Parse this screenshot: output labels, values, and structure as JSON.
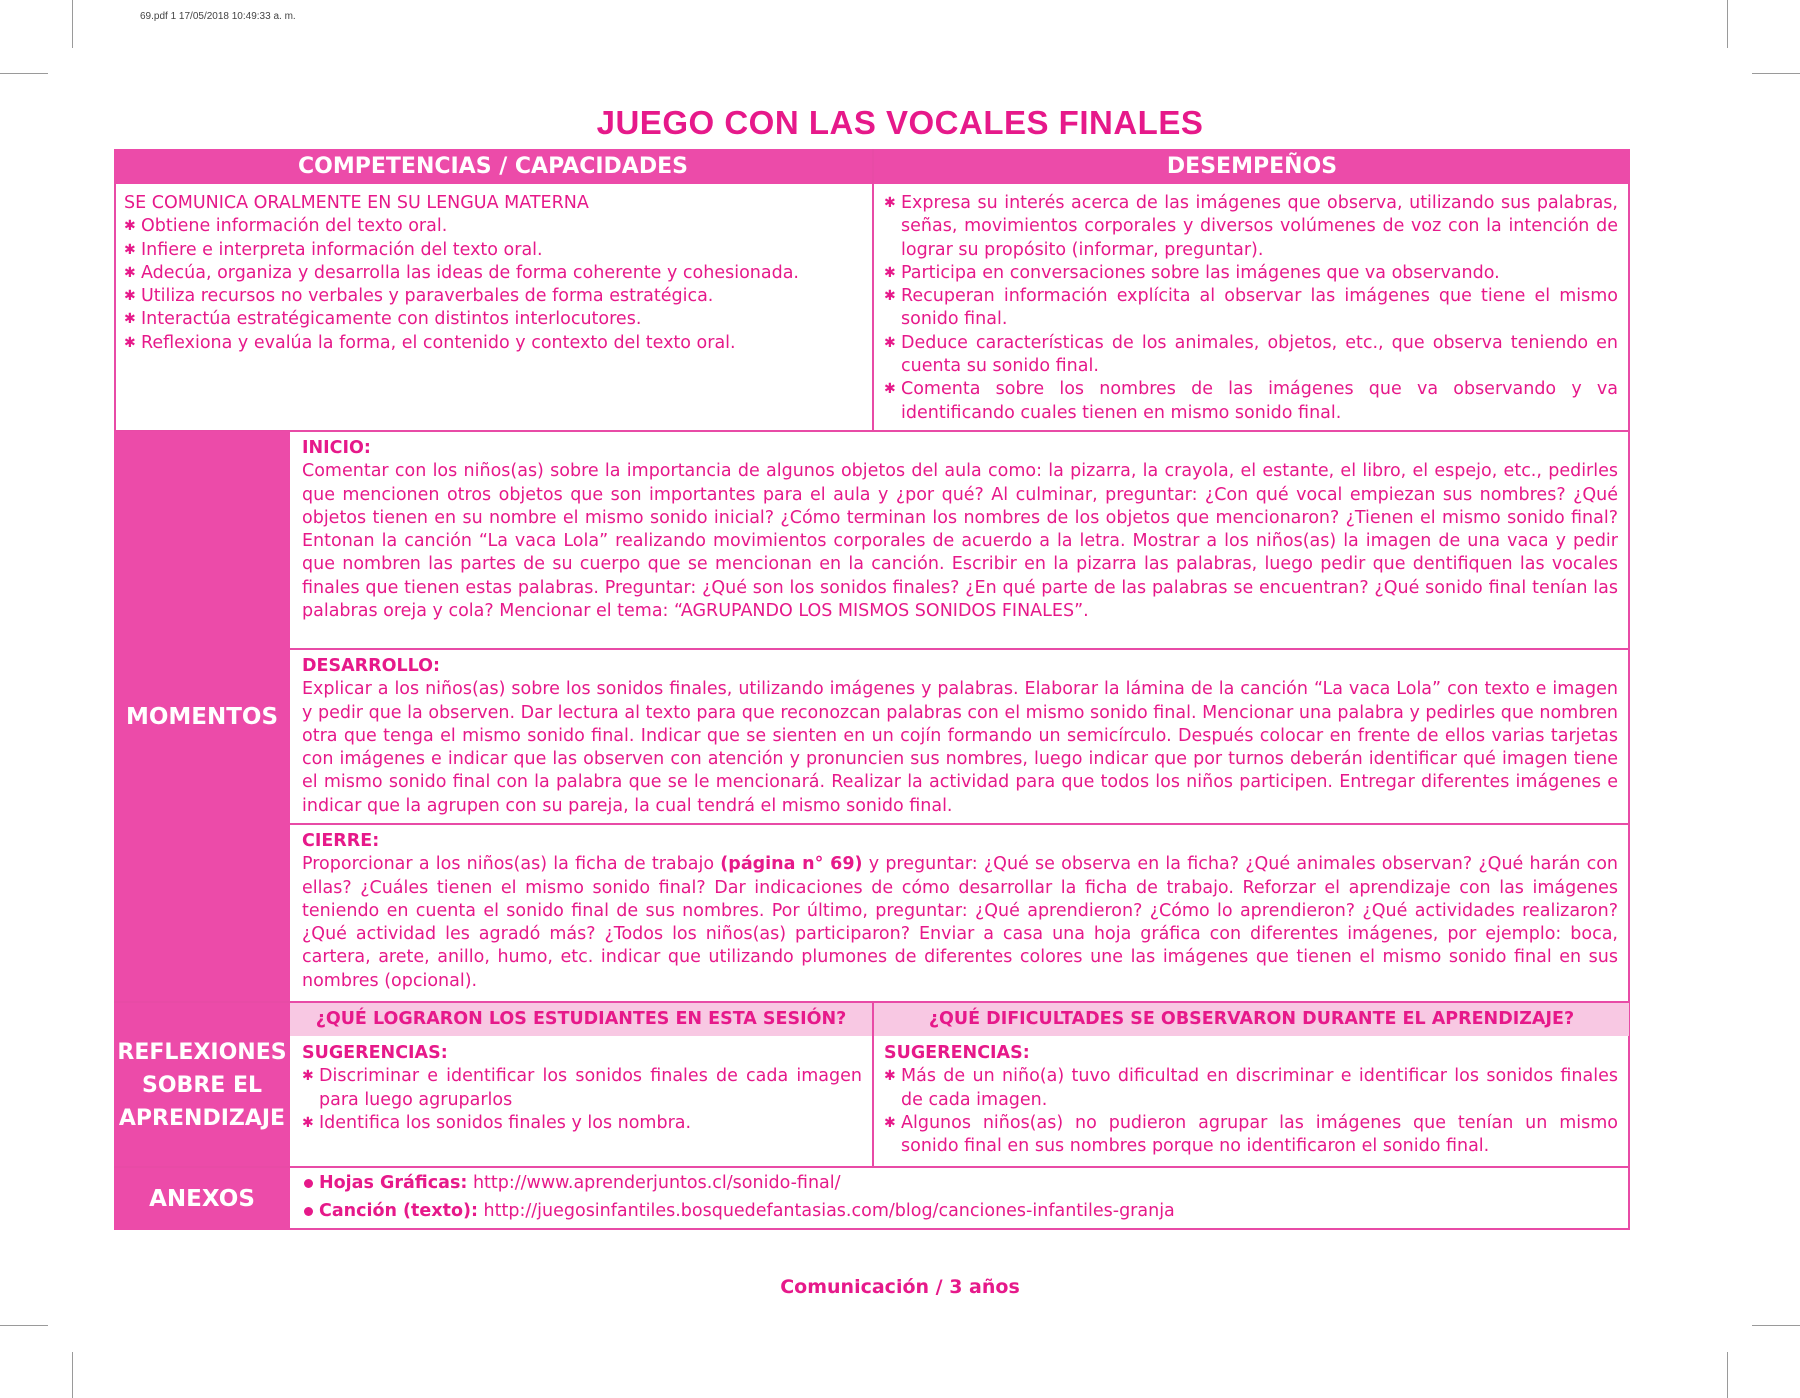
{
  "slug": "69.pdf   1   17/05/2018   10:49:33 a. m.",
  "title": "JUEGO CON LAS VOCALES FINALES",
  "headers": {
    "left": "COMPETENCIAS / CAPACIDADES",
    "right": "DESEMPEÑOS"
  },
  "competencias": {
    "heading": "SE COMUNICA ORALMENTE EN SU LENGUA MATERNA",
    "items": [
      "Obtiene información del texto oral.",
      "Infiere e interpreta información del texto oral.",
      "Adecúa, organiza y desarrolla las ideas de forma coherente y cohesionada.",
      "Utiliza recursos no verbales y paraverbales de forma estratégica.",
      "Interactúa estratégicamente con distintos interlocutores.",
      "Reflexiona y evalúa la forma, el contenido y contexto del texto oral."
    ]
  },
  "desempenos": {
    "items": [
      "Expresa su interés acerca de las imágenes que observa, utilizando sus palabras, señas, movimientos corporales y diversos volúmenes de voz con la intención de lograr su propósito (informar, preguntar).",
      "Participa en conversaciones sobre las imágenes que va observando.",
      "Recuperan información explícita al observar las imágenes que tiene el mismo sonido final.",
      "Deduce características de los animales, objetos, etc., que observa teniendo en cuenta su sonido final.",
      "Comenta sobre los nombres de las imágenes que va observando y va identificando cuales tienen  en mismo sonido final."
    ]
  },
  "momentos": {
    "label": "MOMENTOS",
    "inicio": {
      "title": "INICIO:",
      "text": "Comentar con los niños(as) sobre la importancia de algunos objetos del aula como: la pizarra, la crayola, el estante, el libro, el espejo, etc., pedirles que mencionen otros objetos que son importantes para el aula y ¿por qué? Al culminar, preguntar: ¿Con qué vocal empiezan sus nombres? ¿Qué objetos tienen en su nombre el mismo sonido inicial? ¿Cómo terminan los nombres de los objetos que mencionaron? ¿Tienen el mismo sonido final?  Entonan la canción “La vaca Lola” realizando movimientos corporales de acuerdo a la letra. Mostrar a los niños(as) la imagen de una vaca y pedir que nombren las partes de su cuerpo que se mencionan en la canción. Escribir en la pizarra las palabras, luego pedir que dentifiquen las vocales finales que tienen estas palabras. Preguntar: ¿Qué son los sonidos finales? ¿En qué parte de las palabras se encuentran? ¿Qué sonido final tenían las palabras oreja y cola? Mencionar el tema: “AGRUPANDO LOS MISMOS SONIDOS FINALES”."
    },
    "desarrollo": {
      "title": "DESARROLLO:",
      "text": "Explicar a los niños(as) sobre los sonidos finales, utilizando imágenes y palabras. Elaborar la lámina de la canción “La vaca Lola” con texto e imagen y pedir que la observen. Dar lectura al texto para que reconozcan palabras con el mismo sonido final. Mencionar una palabra y pedirles que nombren otra que tenga el mismo sonido final. Indicar que se sienten en un cojín formando un semicírculo. Después colocar en frente de ellos varias tarjetas con imágenes e indicar que las observen con atención y pronuncien sus nombres, luego indicar que por turnos deberán identificar qué imagen tiene el mismo sonido final con la palabra que se le mencionará. Realizar la actividad para que todos los niños participen. Entregar diferentes imágenes e indicar que la agrupen con su pareja, la cual tendrá el mismo sonido final."
    },
    "cierre": {
      "title": "CIERRE:",
      "text_a": "Proporcionar a los niños(as) la ficha de trabajo ",
      "text_bold": "(página n° 69)",
      "text_b": " y preguntar: ¿Qué se observa en la ficha? ¿Qué animales observan? ¿Qué harán con ellas? ¿Cuáles tienen el mismo sonido final? Dar indicaciones de cómo desarrollar la ficha de trabajo. Reforzar el aprendizaje con las imágenes teniendo en cuenta el sonido final de sus nombres. Por último, preguntar: ¿Qué aprendieron? ¿Cómo lo aprendieron? ¿Qué actividades realizaron? ¿Qué actividad les agradó más? ¿Todos los niños(as) participaron? Enviar a casa una hoja gráfica con diferentes imágenes, por ejemplo: boca, cartera, arete, anillo, humo, etc. indicar que utilizando plumones de diferentes colores une las imágenes que tienen el mismo sonido final en sus nombres (opcional)."
    }
  },
  "reflexiones": {
    "label": "REFLEXIONES SOBRE EL APRENDIZAJE",
    "q_left": "¿QUÉ LOGRARON LOS ESTUDIANTES EN ESTA SESIÓN?",
    "q_right": "¿QUÉ DIFICULTADES SE OBSERVARON DURANTE EL APRENDIZAJE?",
    "left_title": "SUGERENCIAS:",
    "left_items": [
      "Discriminar e identificar los sonidos finales de cada imagen para luego agruparlos",
      "Identifica los sonidos finales y los nombra."
    ],
    "right_title": "SUGERENCIAS:",
    "right_items": [
      "Más de un niño(a) tuvo dificultad en discriminar e identificar los sonidos finales de cada imagen.",
      "Algunos niños(as) no pudieron agrupar las imágenes que tenían un mismo sonido final en sus nombres porque no identificaron el sonido final."
    ]
  },
  "anexos": {
    "label": "ANEXOS",
    "items": [
      {
        "label": "Hojas Gráficas:",
        "url": "http://www.aprenderjuntos.cl/sonido-final/"
      },
      {
        "label": "Canción (texto):",
        "url": "http://juegosinfantiles.bosquedefantasias.com/blog/canciones-infantiles-granja"
      }
    ]
  },
  "footer": "Comunicación / 3 años",
  "colors": {
    "magenta": "#e6198a",
    "header_bg": "#ec4ba9",
    "subheader_bg": "#f8c8e3"
  }
}
